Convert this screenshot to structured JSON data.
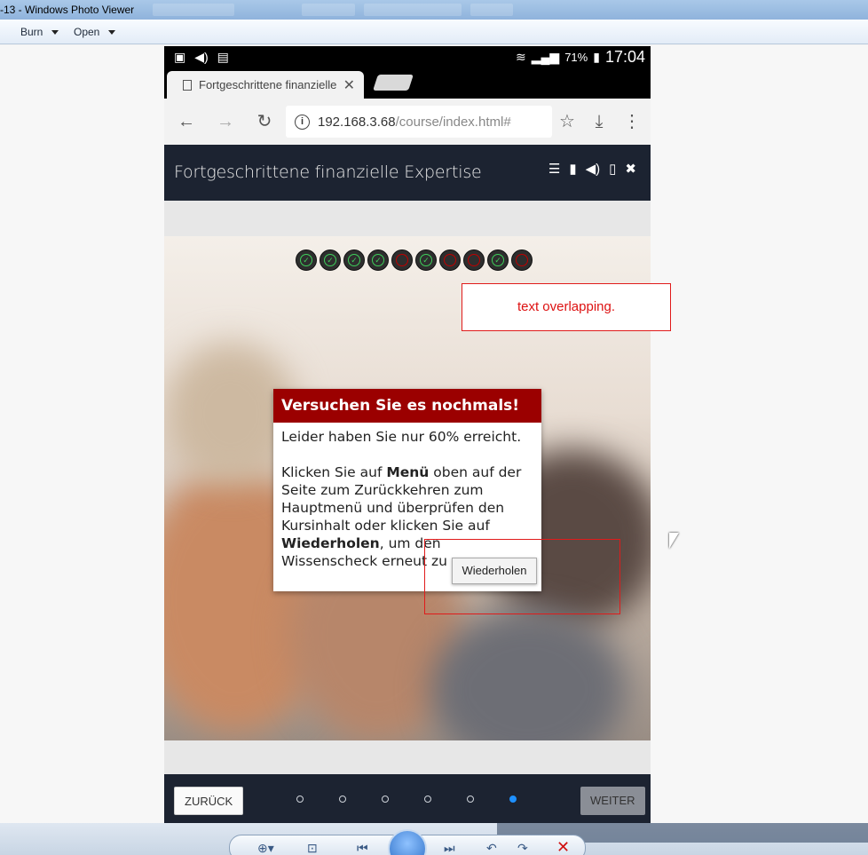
{
  "window": {
    "title": "-13 - Windows Photo Viewer",
    "menu": [
      {
        "label": "Burn"
      },
      {
        "label": "Open"
      }
    ]
  },
  "phone": {
    "statusbar": {
      "battery_pct": "71%",
      "time": "17:04"
    },
    "browser": {
      "tab_title": "Fortgeschrittene finanzielle",
      "url_host": "192.168.3.68",
      "url_path": "/course/index.html#"
    },
    "course": {
      "title": "Fortgeschrittene finanzielle Expertise",
      "progress_dots": [
        {
          "status": "correct"
        },
        {
          "status": "correct"
        },
        {
          "status": "correct"
        },
        {
          "status": "correct"
        },
        {
          "status": "wrong"
        },
        {
          "status": "correct"
        },
        {
          "status": "wrong"
        },
        {
          "status": "wrong"
        },
        {
          "status": "correct"
        },
        {
          "status": "wrong"
        }
      ],
      "dialog": {
        "heading": "Versuchen Sie es nochmals!",
        "result": "Leider haben Sie nur 60% erreicht.",
        "instr_1": "Klicken Sie auf ",
        "instr_menu": "Menü",
        "instr_2": " oben auf der Seite zum Zurückkehren zum Hauptmenü und überprüfen den Kursinhalt oder klicken Sie auf ",
        "instr_retry": "Wiederholen",
        "instr_3": ", um den Wissenscheck erneut zu ",
        "button": "Wiederholen"
      },
      "footer": {
        "prev": "ZURÜCK",
        "next": "WEITER",
        "page_count": 6,
        "active_page": 6
      }
    }
  },
  "annotation": {
    "note": "text overlapping."
  },
  "colors": {
    "course_header": "#1c2331",
    "dialog_header": "#9b0000",
    "correct": "#3ecf5a",
    "wrong": "#c00000",
    "annotation": "#e01b1b",
    "pager_active": "#1e90ff"
  }
}
